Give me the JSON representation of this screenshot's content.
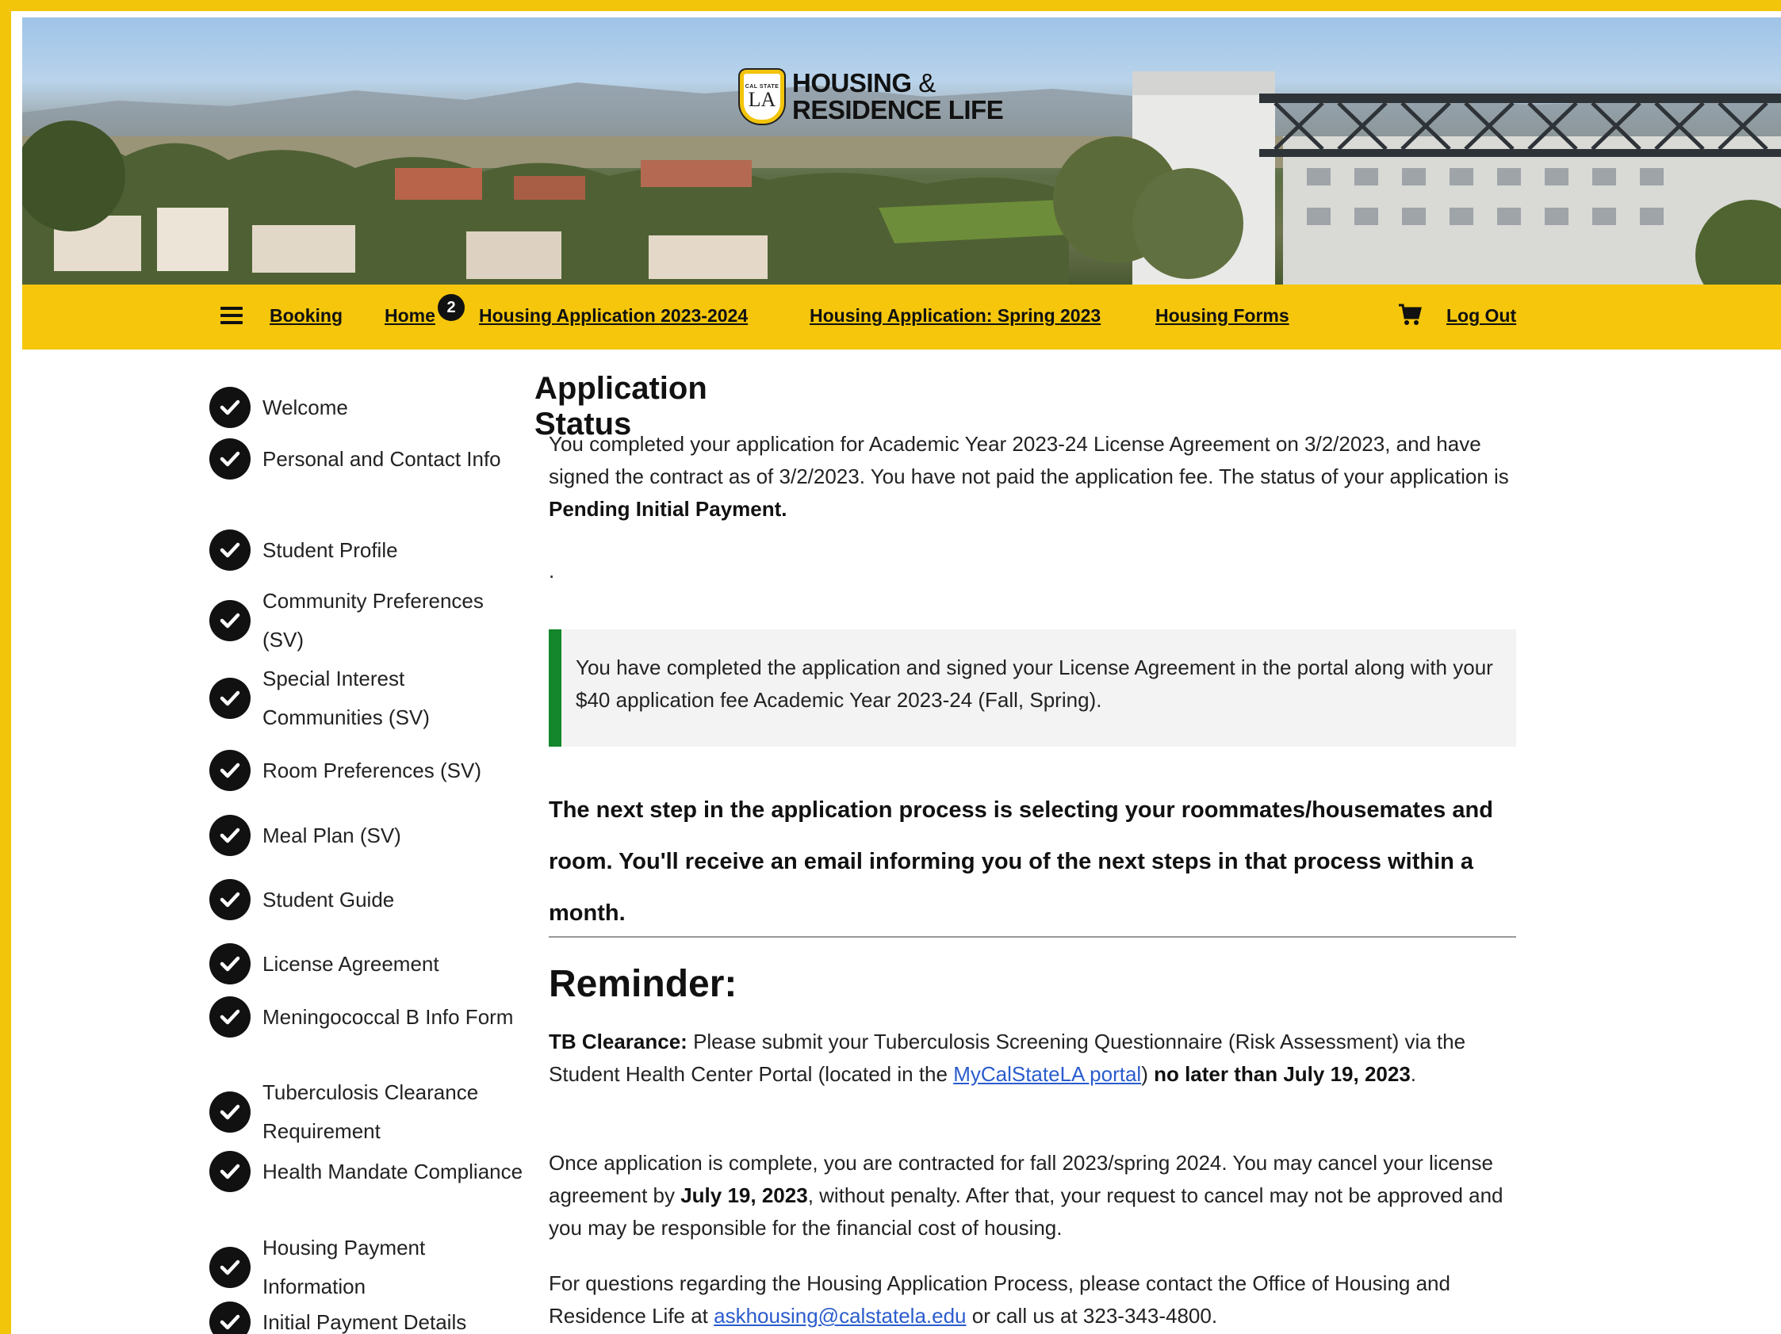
{
  "branding": {
    "shield_small": "CAL STATE",
    "shield_letters": "LA",
    "title_line1": "HOUSING",
    "title_amp": "&",
    "title_line2": "RESIDENCE LIFE"
  },
  "nav": {
    "cart_count": "2",
    "links": [
      "Booking",
      "Home",
      "Housing Application 2023-2024",
      "Housing Application: Spring 2023",
      "Housing Forms"
    ],
    "logout": "Log Out"
  },
  "sidebar": {
    "steps": [
      {
        "label": "Welcome"
      },
      {
        "label": "Personal and Contact Info"
      },
      {
        "label": "Student Profile"
      },
      {
        "label": "Community Preferences (SV)"
      },
      {
        "label": "Special Interest Communities (SV)"
      },
      {
        "label": "Room Preferences (SV)"
      },
      {
        "label": "Meal Plan (SV)"
      },
      {
        "label": "Student Guide"
      },
      {
        "label": "License Agreement"
      },
      {
        "label": "Meningococcal B Info Form"
      },
      {
        "label": "Tuberculosis Clearance Requirement"
      },
      {
        "label": "Health Mandate Compliance"
      },
      {
        "label": "Housing Payment Information"
      },
      {
        "label": "Initial Payment Details"
      }
    ]
  },
  "main": {
    "heading": "Application Status",
    "status_text": "You completed your application for Academic Year 2023-24 License Agreement on 3/2/2023, and have signed the contract as of 3/2/2023. You have not paid the application fee. The status of your application is ",
    "status_value": "Pending Initial Payment.",
    "dot": ".",
    "notice": "You have completed the application and signed your License Agreement in the portal along with your $40 application fee Academic Year 2023-24 (Fall, Spring).",
    "next_step": "The next step in the application process is selecting your roommates/housemates and room. You'll receive an email informing you of the next steps in that process within a month.",
    "reminder_heading": "Reminder:",
    "tb_label": "TB Clearance:",
    "tb_text1": " Please submit your Tuberculosis Screening Questionnaire (Risk Assessment) via the Student Health Center Portal (located in the ",
    "tb_link": "MyCalStateLA portal",
    "tb_text2": ") ",
    "tb_deadline": "no later than July 19, 2023",
    "tb_end": ".",
    "cancel_text1": "Once application is complete, you are contracted for fall 2023/spring 2024. You may cancel your license agreement by ",
    "cancel_date": "July 19, 2023",
    "cancel_text2": ", without penalty. After that, your request to cancel may not be approved and you may be responsible for the financial cost of housing.",
    "contact_text1": "For questions regarding the Housing Application Process, please contact the Office of Housing and Residence Life at ",
    "contact_email": "askhousing@calstatela.edu",
    "contact_text2": " or call us at 323-343-4800."
  },
  "colors": {
    "brand_yellow": "#f5c60c",
    "notice_green": "#14862b",
    "link_blue": "#2a5ccd"
  }
}
